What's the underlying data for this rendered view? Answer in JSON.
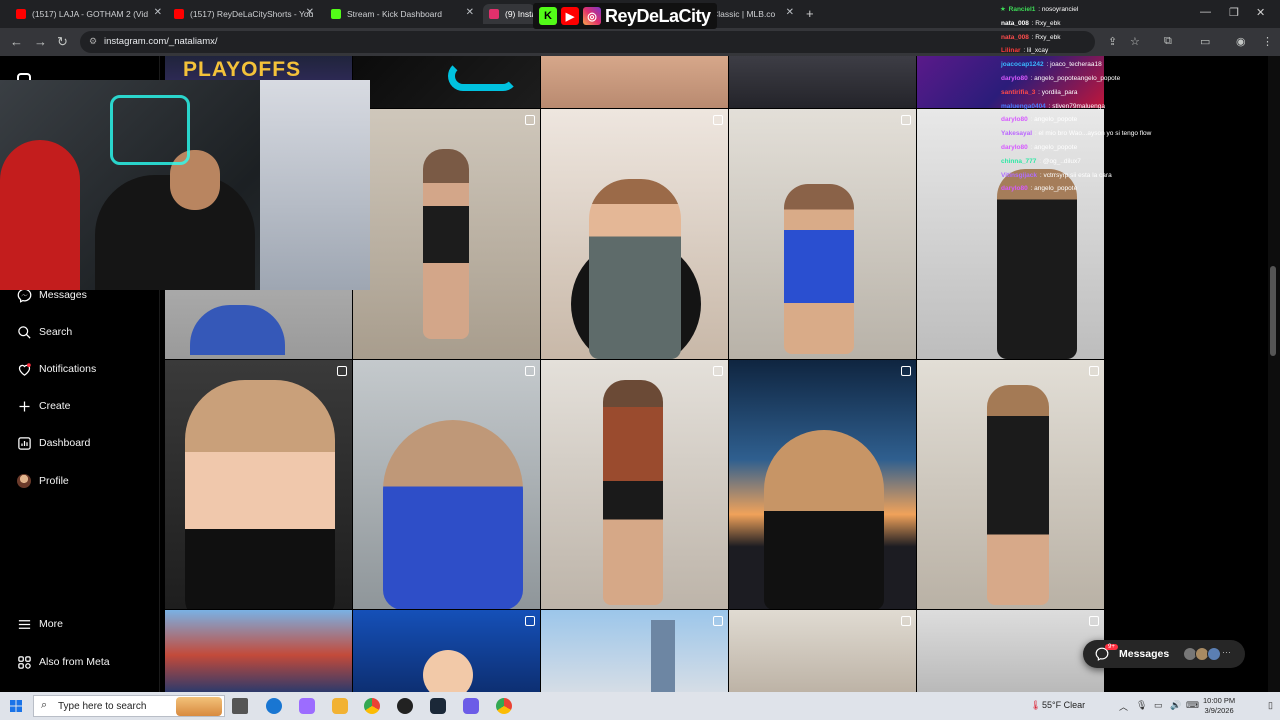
{
  "browser": {
    "tabs": [
      {
        "label": "(1517) LAJA - GOTHAM 2 (Vid",
        "icon": "youtube-icon",
        "color": "#ff0000"
      },
      {
        "label": "(1517) ReyDeLaCityShorts - You",
        "icon": "youtube-icon",
        "color": "#ff0000"
      },
      {
        "label": "Stream - Kick Dashboard",
        "icon": "kick-icon",
        "color": "#53fc18"
      },
      {
        "label": "(9) Insta",
        "icon": "instagram-icon",
        "color": "#e1306c"
      },
      {
        "label": "ll Classic | MLB.co",
        "icon": "mlb-icon",
        "color": "#1a3a8a"
      }
    ],
    "address": "instagram.com/_nataliamx/"
  },
  "overlay": {
    "brand_handle": "ReyDeLaCity",
    "chat": [
      {
        "user": "Ranciel1",
        "color": "#3ddc57",
        "msg": "nosoyranciel",
        "star": true
      },
      {
        "user": "nata_008",
        "color": "#ffffff",
        "msg": "Rxy_ebk"
      },
      {
        "user": "nata_008",
        "color": "#ff4d4d",
        "msg": "Rxy_ebk"
      },
      {
        "user": "Lilinar",
        "color": "#ff3a3a",
        "msg": "lil_xcay"
      },
      {
        "user": "joacocap1242",
        "color": "#3ab8ff",
        "msg": "joaco_techeraa18"
      },
      {
        "user": "darylo80",
        "color": "#d659ff",
        "msg": "angelo_popoteangelo_popote"
      },
      {
        "user": "santirifia_3",
        "color": "#ff4a4a",
        "msg": "yordila_para"
      },
      {
        "user": "maluenga0404",
        "color": "#4a7dff",
        "msg": "stiven79maluenga"
      },
      {
        "user": "darylo80",
        "color": "#d659ff",
        "msg": "angelo_popote"
      },
      {
        "user": "Yakesayal",
        "color": "#bb66ff",
        "msg": "el mio bro Wao...ayson yo si tengo flow"
      },
      {
        "user": "darylo80",
        "color": "#d659ff",
        "msg": "angelo_popote"
      },
      {
        "user": "chinna_777",
        "color": "#2ee8a5",
        "msg": "@og_..dilux7"
      },
      {
        "user": "Vitinsgijack",
        "color": "#b06dff",
        "msg": "vctrrsyrp sii esta la cara"
      },
      {
        "user": "darylo80",
        "color": "#d659ff",
        "msg": "angelo_popote"
      }
    ]
  },
  "sidebar": {
    "items": [
      {
        "label": "Messages",
        "icon": "messenger-icon"
      },
      {
        "label": "Search",
        "icon": "search-icon"
      },
      {
        "label": "Notifications",
        "icon": "heart-icon"
      },
      {
        "label": "Create",
        "icon": "plus-icon"
      },
      {
        "label": "Dashboard",
        "icon": "dashboard-icon"
      },
      {
        "label": "Profile",
        "icon": "avatar-icon"
      }
    ],
    "bottom": [
      {
        "label": "More",
        "icon": "hamburger-icon"
      },
      {
        "label": "Also from Meta",
        "icon": "meta-icon"
      }
    ]
  },
  "feed": {
    "top_banner_text": "PLAYOFFS"
  },
  "messages_pill": {
    "label": "Messages",
    "badge": "9+"
  },
  "taskbar": {
    "search_placeholder": "Type here to search",
    "weather": "55°F  Clear",
    "time": "10:00 PM",
    "date": "3/9/2026"
  }
}
